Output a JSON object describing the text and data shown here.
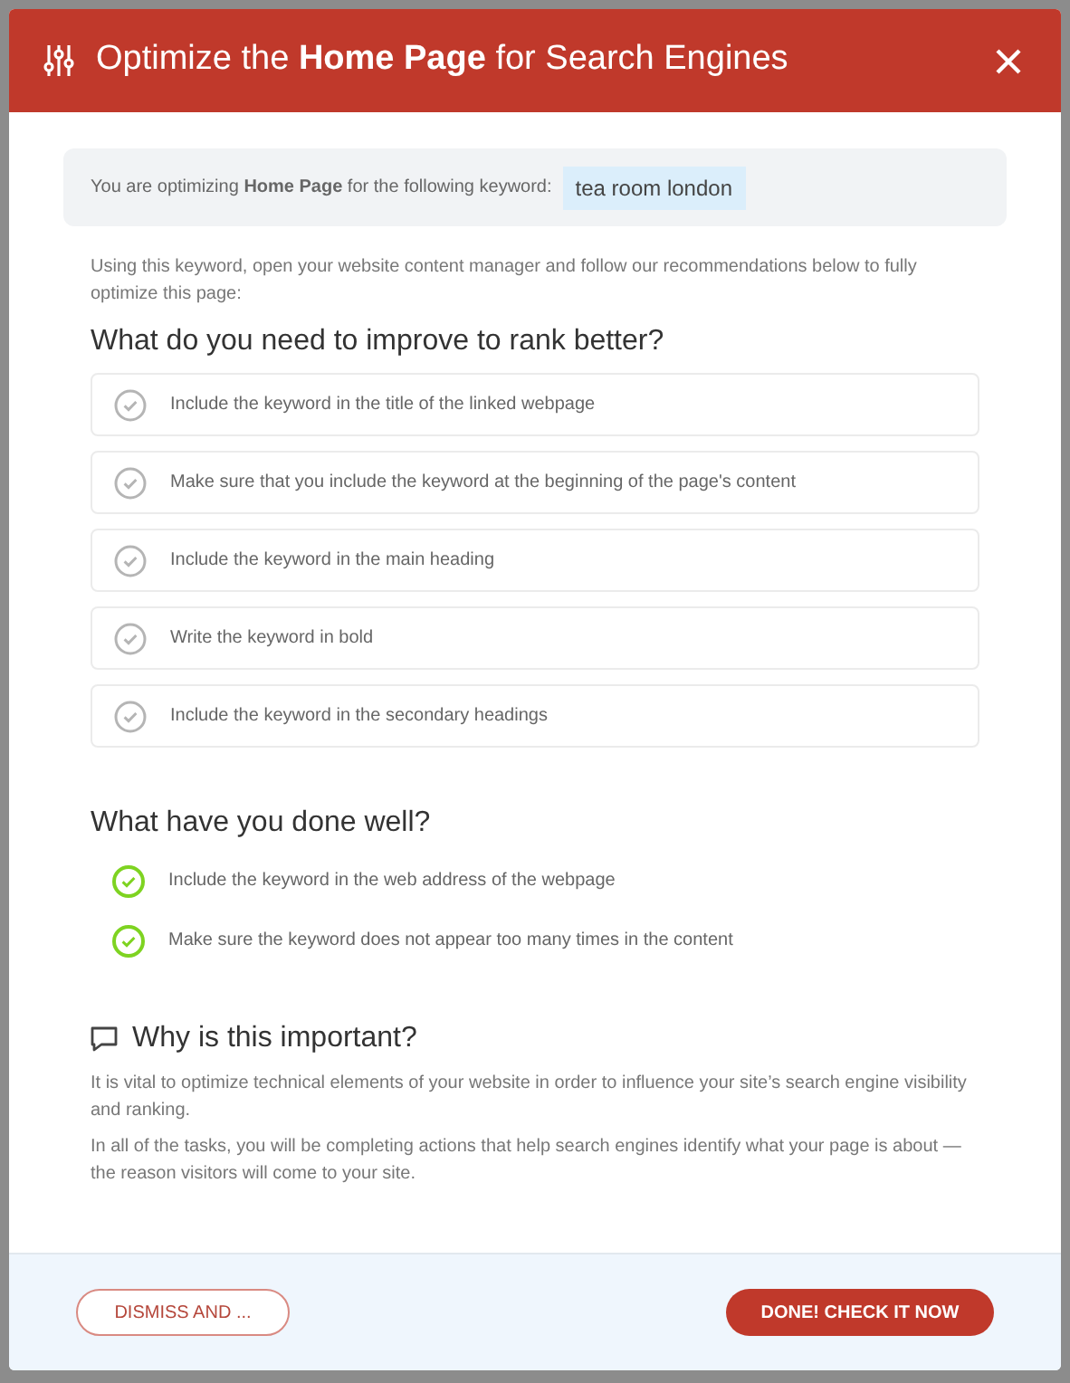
{
  "dialog": {
    "title": "Optimize the **Home Page** for Search Engines"
  },
  "keyword_box": {
    "text": "You are optimizing **Home Page** for the following keyword:",
    "keyword": "tea room london"
  },
  "intro": "Using this keyword, open your website content manager and follow our recommendations below to fully optimize this page:",
  "improve": {
    "heading": "What do you need to improve to rank better?",
    "items": [
      {
        "text": "Include the keyword in the title of the linked webpage",
        "done": false
      },
      {
        "text": "Make sure that you include the keyword at the beginning of the page's content",
        "done": false
      },
      {
        "text": "Include the keyword in the main heading",
        "done": false
      },
      {
        "text": "Write the keyword in bold",
        "done": false
      },
      {
        "text": "Include the keyword in the secondary headings",
        "done": false
      }
    ]
  },
  "done_well": {
    "heading": "What have you done well?",
    "items": [
      {
        "text": "Include the keyword in the web address of the webpage",
        "done": true
      },
      {
        "text": "Make sure the keyword does not appear too many times in the content",
        "done": true
      }
    ]
  },
  "why": {
    "heading": "Why is this important?",
    "paragraphs": [
      "It is vital to optimize technical elements of your website in order to influence your site’s search engine visibility and ranking.",
      "In all of the tasks, you will be completing actions that help search engines identify what your page is about — the reason visitors will come to your site."
    ]
  },
  "buttons": {
    "secondary": "DISMISS AND ...",
    "primary": "DONE! CHECK IT NOW"
  }
}
